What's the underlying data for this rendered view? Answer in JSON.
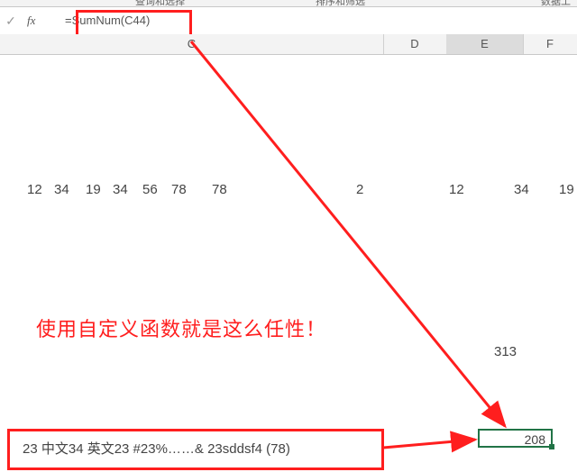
{
  "ribbon": {
    "item1": "查询和选择",
    "item2": "排序和筛选",
    "item3": "数据工"
  },
  "formulaBar": {
    "fxLabel": "fx",
    "value": "=SumNum(C44)"
  },
  "columns": {
    "C": "C",
    "D": "D",
    "E": "E",
    "F": "F"
  },
  "numbersRow": {
    "n1": "12",
    "n2": "34",
    "n3": "19",
    "n4": "34",
    "n5": "56",
    "n6": "78",
    "n7": "78",
    "n8": "2",
    "n9": "12",
    "n10": "34",
    "n11": "19"
  },
  "caption": "使用自定义函数就是这么任性！",
  "val313": "313",
  "bottomText": "23  中文34   英文23  #23%……&   23sddsf4     (78)",
  "resultCell": "208"
}
